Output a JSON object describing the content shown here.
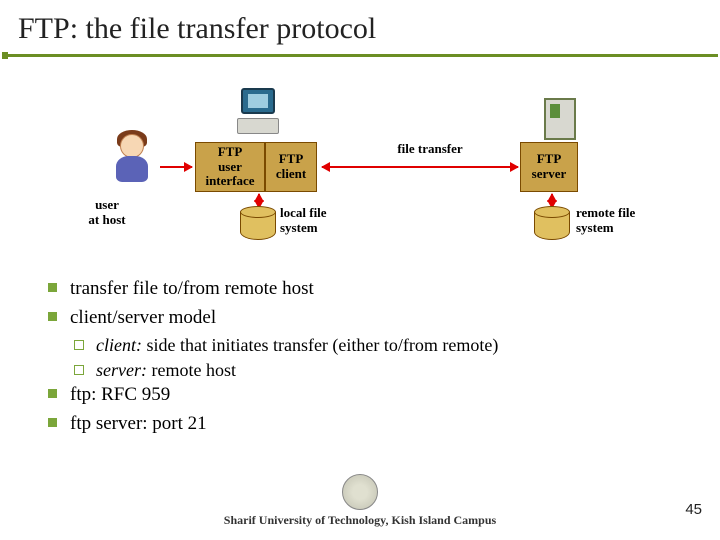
{
  "title": "FTP: the file transfer protocol",
  "diagram": {
    "user_at_host": "user\nat host",
    "ftp_ui": "FTP\nuser\ninterface",
    "ftp_client": "FTP\nclient",
    "file_transfer": "file transfer",
    "ftp_server": "FTP\nserver",
    "local_fs": "local file\nsystem",
    "remote_fs": "remote file\nsystem"
  },
  "bullets": {
    "b1": "transfer file to/from remote host",
    "b2": "client/server model",
    "b2a_em": "client:",
    "b2a_rest": " side that initiates transfer (either to/from remote)",
    "b2b_em": "server:",
    "b2b_rest": " remote host",
    "b3": "ftp: RFC 959",
    "b4": "ftp server: port 21"
  },
  "footer": "Sharif University of Technology, Kish Island Campus",
  "page": "45"
}
